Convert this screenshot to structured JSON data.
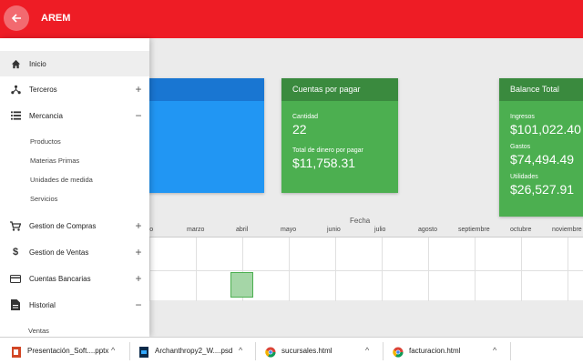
{
  "app": {
    "title": "AREM"
  },
  "cards": [
    {
      "title": "Cuentas por pagar",
      "rows": [
        {
          "label": "Cantidad",
          "value": "22"
        },
        {
          "label": "Total de dinero por pagar",
          "value": "$11,758.31"
        }
      ]
    },
    {
      "title": "Balance Total",
      "rows": [
        {
          "label": "Ingresos",
          "value": "$101,022.40"
        },
        {
          "label": "Gastos",
          "value": "$74,494.49"
        },
        {
          "label": "Utilidades",
          "value": "$26,527.91"
        }
      ]
    }
  ],
  "chart": {
    "axis_title": "Fecha",
    "months": [
      "ero",
      "marzo",
      "abril",
      "mayo",
      "junio",
      "julio",
      "agosto",
      "septiembre",
      "octubre",
      "noviembre"
    ]
  },
  "sidebar": {
    "items": [
      {
        "label": "Inicio",
        "icon": "home-icon",
        "toggle": ""
      },
      {
        "label": "Terceros",
        "icon": "hierarchy-icon",
        "toggle": "+"
      },
      {
        "label": "Mercancia",
        "icon": "list-icon",
        "toggle": "−"
      },
      {
        "label": "Gestion de Compras",
        "icon": "cart-icon",
        "toggle": "+"
      },
      {
        "label": "Gestion de Ventas",
        "icon": "dollar-icon",
        "toggle": "+"
      },
      {
        "label": "Cuentas Bancarias",
        "icon": "bank-card-icon",
        "toggle": "+"
      },
      {
        "label": "Historial",
        "icon": "document-icon",
        "toggle": "−"
      }
    ],
    "mercancia_sub": [
      "Productos",
      "Materias Primas",
      "Unidades de medida",
      "Servicios"
    ],
    "historial_sub": [
      "Ventas"
    ]
  },
  "downloads": [
    {
      "name": "Presentación_Soft....pptx",
      "icon": "powerpoint-file-icon"
    },
    {
      "name": "Archanthropy2_W....psd",
      "icon": "photoshop-file-icon"
    },
    {
      "name": "sucursales.html",
      "icon": "chrome-file-icon"
    },
    {
      "name": "facturacion.html",
      "icon": "chrome-file-icon"
    }
  ],
  "colors": {
    "topbar": "#ee1c25",
    "card_blue": "#2196f3",
    "card_green": "#4caf50",
    "card_green_header": "#3a8a3e"
  }
}
